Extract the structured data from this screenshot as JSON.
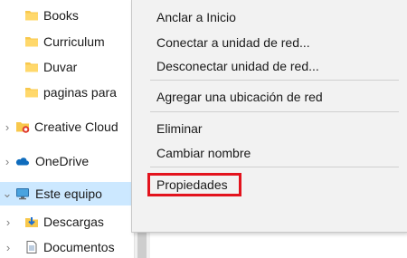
{
  "nav_pane": {
    "items": [
      {
        "label": "Books",
        "icon": "folder-icon"
      },
      {
        "label": "Curriculum",
        "icon": "folder-icon"
      },
      {
        "label": "Duvar",
        "icon": "folder-icon"
      },
      {
        "label": "paginas para",
        "icon": "folder-icon"
      },
      {
        "label": "Creative Cloud",
        "icon": "creative-cloud-icon"
      },
      {
        "label": "OneDrive",
        "icon": "onedrive-icon"
      },
      {
        "label": "Este equipo",
        "icon": "computer-icon",
        "selected": true
      },
      {
        "label": "Descargas",
        "icon": "downloads-icon"
      },
      {
        "label": "Documentos",
        "icon": "documents-icon"
      }
    ]
  },
  "context_menu": {
    "items": [
      {
        "label": "Anclar a Inicio"
      },
      {
        "label": "Conectar a unidad de red..."
      },
      {
        "label": "Desconectar unidad de red..."
      },
      {
        "label": "Agregar una ubicación de red"
      },
      {
        "label": "Eliminar"
      },
      {
        "label": "Cambiar nombre"
      },
      {
        "label": "Propiedades",
        "highlighted": true
      }
    ]
  },
  "colors": {
    "selection": "#cce8ff",
    "menu_background": "#f2f2f2",
    "highlight_border": "#e3131d",
    "folder": "#f8c84c"
  }
}
